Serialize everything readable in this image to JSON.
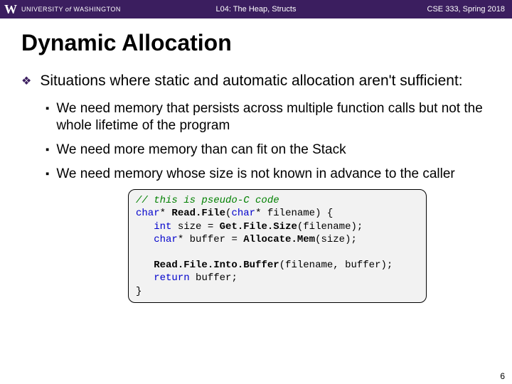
{
  "header": {
    "university_prefix": "UNIVERSITY",
    "university_of": "of",
    "university_name": "WASHINGTON",
    "lecture": "L04: The Heap, Structs",
    "course": "CSE 333, Spring 2018"
  },
  "title": "Dynamic Allocation",
  "point1": "Situations where static and automatic allocation aren't sufficient:",
  "sub1": "We need memory that persists across multiple function calls but not the whole lifetime of the program",
  "sub2": "We need more memory than can fit on the Stack",
  "sub3": "We need memory whose size is not known in advance to the caller",
  "code": {
    "l1": "// this is pseudo-C code",
    "l2a": "char",
    "l2b": "* ",
    "l2c": "Read.File",
    "l2d": "(",
    "l2e": "char",
    "l2f": "* filename) {",
    "l3a": "   ",
    "l3b": "int",
    "l3c": " size = ",
    "l3d": "Get.File.Size",
    "l3e": "(filename);",
    "l4a": "   ",
    "l4b": "char",
    "l4c": "* buffer = ",
    "l4d": "Allocate.Mem",
    "l4e": "(size);",
    "l5": "",
    "l6a": "   ",
    "l6b": "Read.File.Into.Buffer",
    "l6c": "(filename, buffer);",
    "l7a": "   ",
    "l7b": "return",
    "l7c": " buffer;",
    "l8": "}"
  },
  "page_number": "6"
}
